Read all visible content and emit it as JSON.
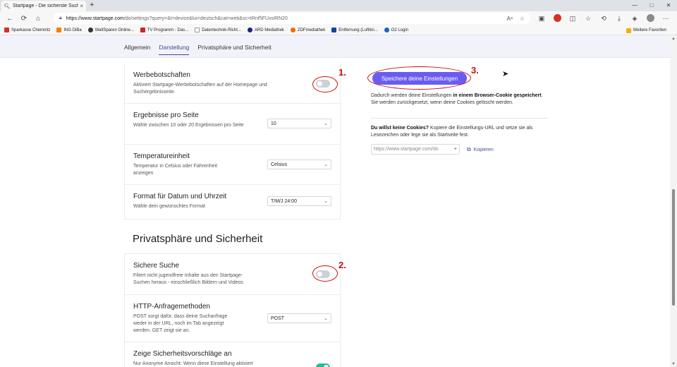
{
  "browser": {
    "tab_title": "Startpage - Die sicherste Suchm...",
    "tab_icon": "search-icon",
    "tab_close": "×",
    "new_tab": "+",
    "window_controls": [
      "—",
      "□",
      "✕"
    ],
    "nav": [
      "←",
      "⟳",
      "⌂"
    ],
    "url_host": "https://www.startpage.com",
    "url_path": "/do/settings?query=&t=device&lui=deutsch&cat=web&sc=tRnf5FUxsIRN20",
    "url_right_icons": [
      "Aᵃ",
      "☆"
    ],
    "toolbar_icons": [
      "▣",
      "●",
      "◫",
      "☆",
      "⟲",
      "⤓",
      "◈",
      "●",
      "⋯"
    ]
  },
  "bookmarks": [
    {
      "label": "Sparkasse Chemnitz",
      "color": "#d32f2f"
    },
    {
      "label": "ING DiBa",
      "color": "#ff7a00"
    },
    {
      "label": "WaltSparen Online...",
      "color": "#333333"
    },
    {
      "label": "TV Programm - Das...",
      "color": "#c62828"
    },
    {
      "label": "Datentechnik-Richt...",
      "color": "#9e9e9e"
    },
    {
      "label": "ARD Mediathek",
      "color": "#1a237e"
    },
    {
      "label": "ZDFmediathek",
      "color": "#ef6c00"
    },
    {
      "label": "Entfernung (Luftlini...",
      "color": "#0d47a1"
    },
    {
      "label": "O2 Login",
      "color": "#1565c0"
    }
  ],
  "bookmarks_right": {
    "label": "Weitere Favoriten",
    "color": "#f2b000"
  },
  "settings_nav": {
    "tabs": [
      "Allgemein",
      "Darstellung",
      "Privatsphäre und Sicherheit"
    ],
    "active_index": 1
  },
  "appearance_rows": {
    "werbe": {
      "title": "Werbebotschaften",
      "desc": "Aktiviert Startpage-Werbebotschaften auf der Homepage und Suchergebnisseite.",
      "toggle": "off"
    },
    "ergebnisse": {
      "title": "Ergebnisse pro Seite",
      "desc": "Wähle zwischen 10 oder 20 Ergebnissen pro Seite",
      "select": "10"
    },
    "temperatur": {
      "title": "Temperatureinheit",
      "desc": "Temperatur in Celsius oder Fahrenheit anzeigen",
      "select": "Celsius"
    },
    "datum": {
      "title": "Format für Datum und Uhrzeit",
      "desc": "Wähle dein gewünschtes Format",
      "select": "T/M/J 24:00"
    }
  },
  "privacy_section": {
    "title": "Privatsphäre und Sicherheit",
    "sichere": {
      "title": "Sichere Suche",
      "desc": "Filtert nicht jugendfreie Inhalte aus den Startpage-Suchen heraus - einschließlich Bildern und Videos",
      "toggle": "off"
    },
    "http": {
      "title": "HTTP-Anfragemethoden",
      "desc": "POST sorgt dafür, dass deine Suchanfrage weder in der URL, noch im Tab angezeigt werden. GET zeigt sie an.",
      "select": "POST"
    },
    "vorschlaege": {
      "title": "Zeige Sicherheitsvorschläge an",
      "desc": "Nur Anonyme Ansicht: Wenn diese Einstellung aktiviert",
      "toggle": "on"
    }
  },
  "save_panel": {
    "button": "Speichere deine Einstellungen",
    "info_pre": "Dadurch werden deine Einstellungen ",
    "info_bold": "in einem Browser-Cookie gespeichert",
    "info_post": ". Sie werden zurückgesetzt, wenn deine Cookies gelöscht werden.",
    "nocookie_bold": "Du willst keine Cookies?",
    "nocookie_text": " Kopiere die Einstellungs-URL und setze sie als Lesezeichen oder lege sie als Startseite fest.",
    "url_placeholder": "https://www.startpage.com/do",
    "url_plus": "+",
    "copy_label": "Kopieren"
  },
  "annotations": [
    "1.",
    "2.",
    "3."
  ],
  "colors": {
    "accent": "#6a5cf0",
    "annotation": "#c80e0e",
    "toggle_on": "#1fbf96",
    "link": "#3e4fa0"
  }
}
